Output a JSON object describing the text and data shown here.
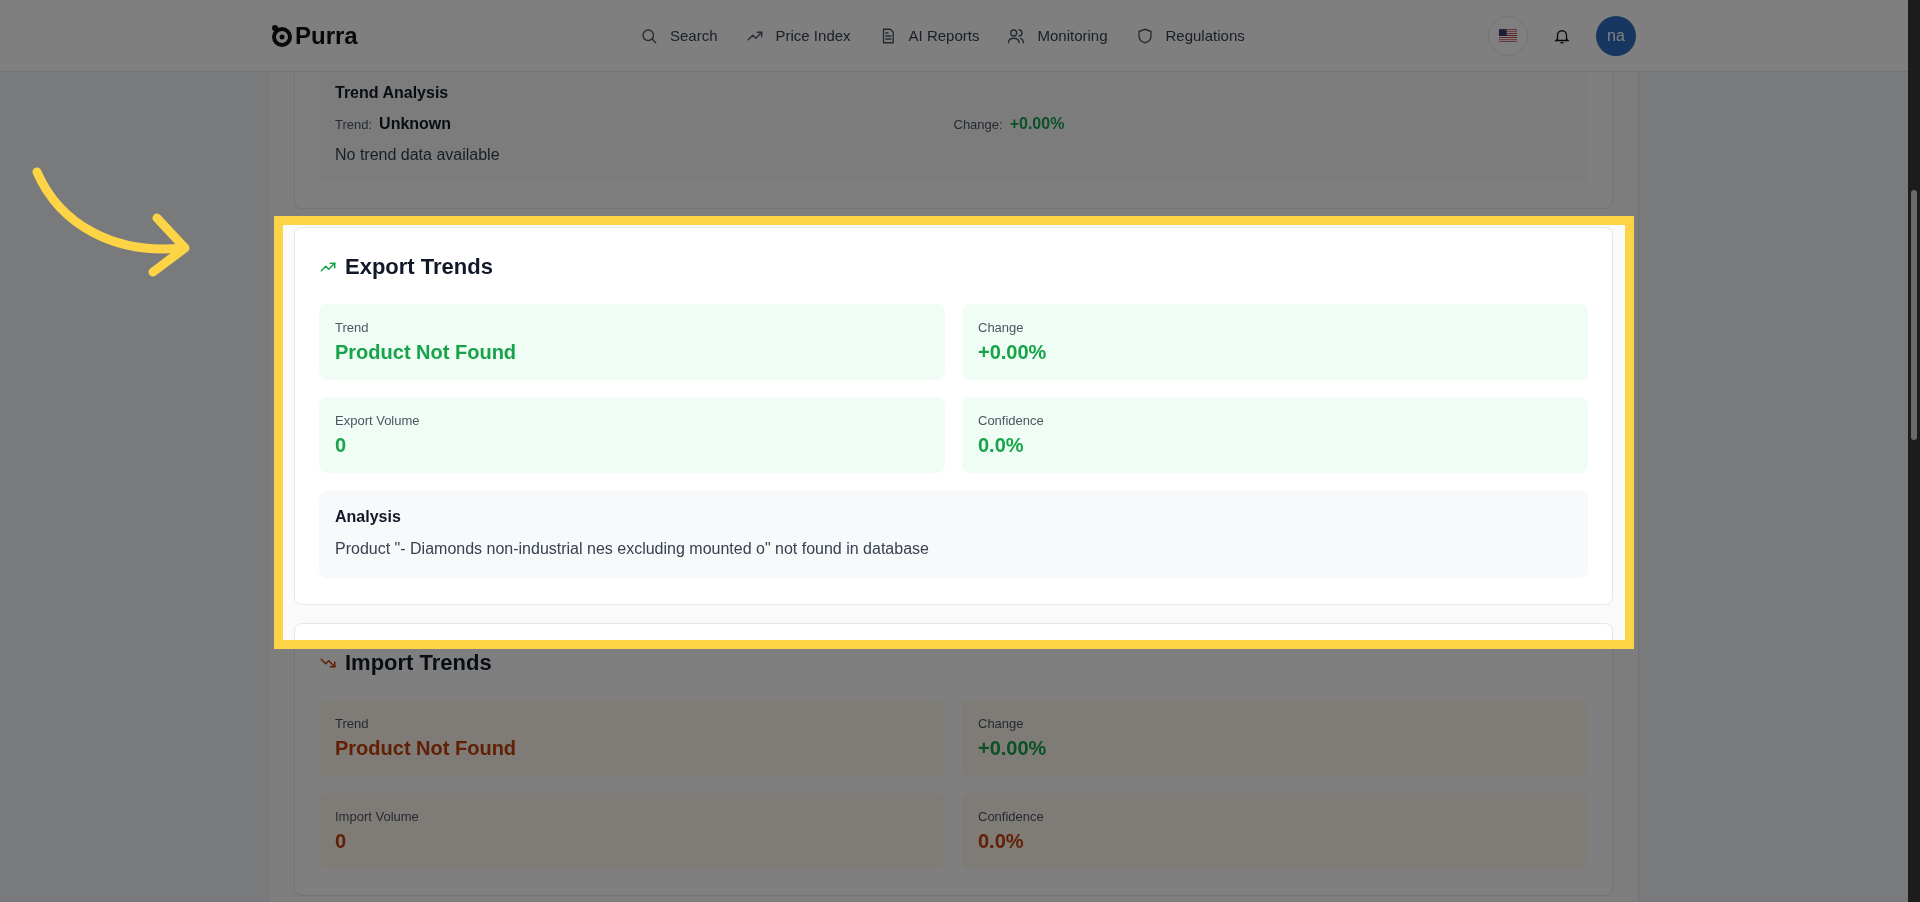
{
  "header": {
    "logo": "Purra",
    "nav": [
      {
        "label": "Search"
      },
      {
        "label": "Price Index"
      },
      {
        "label": "AI Reports"
      },
      {
        "label": "Monitoring"
      },
      {
        "label": "Regulations"
      }
    ],
    "avatar": "na"
  },
  "trend_analysis": {
    "title": "Trend Analysis",
    "trend_label": "Trend:",
    "trend_value": "Unknown",
    "change_label": "Change:",
    "change_value": "+0.00%",
    "note": "No trend data available"
  },
  "sections": [
    {
      "title": "Export Trends",
      "kind": "rising",
      "highlighted": true,
      "stats": [
        {
          "label": "Trend",
          "value": "Product Not Found",
          "kind": "gain"
        },
        {
          "label": "Change",
          "value": "+0.00%",
          "kind": "gain"
        },
        {
          "label": "Export Volume",
          "value": "0",
          "kind": "gain"
        },
        {
          "label": "Confidence",
          "value": "0.0%",
          "kind": "gain"
        }
      ],
      "analysis": {
        "title": "Analysis",
        "text": "Product \"- Diamonds non-industrial nes excluding mounted o\" not found in database"
      }
    },
    {
      "title": "Import Trends",
      "kind": "falling",
      "highlighted": false,
      "stats": [
        {
          "label": "Trend",
          "value": "Product Not Found",
          "kind": "loss"
        },
        {
          "label": "Change",
          "value": "+0.00%",
          "kind": "gain"
        },
        {
          "label": "Import Volume",
          "value": "0",
          "kind": "loss"
        },
        {
          "label": "Confidence",
          "value": "0.0%",
          "kind": "loss"
        }
      ]
    }
  ]
}
